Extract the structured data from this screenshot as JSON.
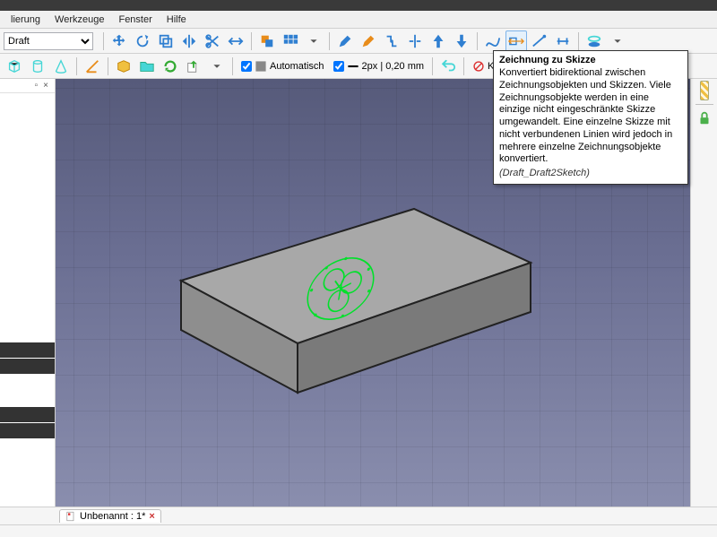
{
  "menu": {
    "items": [
      "lierung",
      "Werkzeuge",
      "Fenster",
      "Hilfe"
    ]
  },
  "workbench": {
    "selected": "Draft",
    "options": [
      "Draft"
    ]
  },
  "toolbar2": {
    "auto_label": "Automatisch",
    "lineweight": "2px | 0,20 mm",
    "kein": "Kein"
  },
  "tooltip": {
    "title": "Zeichnung zu Skizze",
    "body": "Konvertiert bidirektional zwischen Zeichnungsobjekten und Skizzen. Viele Zeichnungsobjekte werden in eine einzige nicht eingeschränkte Skizze umgewandelt. Eine einzelne Skizze mit nicht verbundenen Linien wird jedoch in mehrere einzelne Zeichnungsobjekte konvertiert.",
    "command": "(Draft_Draft2Sketch)"
  },
  "document": {
    "tab_label": "Unbenannt : 1*",
    "close": "×"
  },
  "colors": {
    "accent_blue": "#2f7fd1",
    "accent_green": "#00e02a",
    "accent_orange": "#e88c1a",
    "accent_cyan": "#46d6d6"
  },
  "icons": {
    "move": "move",
    "rotate": "rotate",
    "sync": "sync",
    "offset": "offset",
    "mirror": "mirror",
    "trim": "trim",
    "scale": "scale",
    "array": "array",
    "path": "path",
    "clone": "clone",
    "upgrade": "upgrade",
    "downgrade": "downgrade",
    "draft2sk": "draft2sk",
    "wire": "wire",
    "shape2d": "shape2d",
    "split": "split",
    "heal": "heal",
    "box": "box",
    "cylinder": "cylinder",
    "torus": "torus",
    "angle": "angle",
    "open": "open",
    "folder": "folder",
    "refresh": "refresh",
    "export": "export",
    "autostyle": "autostyle",
    "lineweight": "lineweight",
    "back": "back",
    "prohibit": "prohibit",
    "snap1": "snap",
    "snap2": "snap",
    "snap3": "snap",
    "snap4": "snap",
    "snap5": "snap",
    "snap6": "snap",
    "hatch": "hatch",
    "lock": "lock"
  }
}
